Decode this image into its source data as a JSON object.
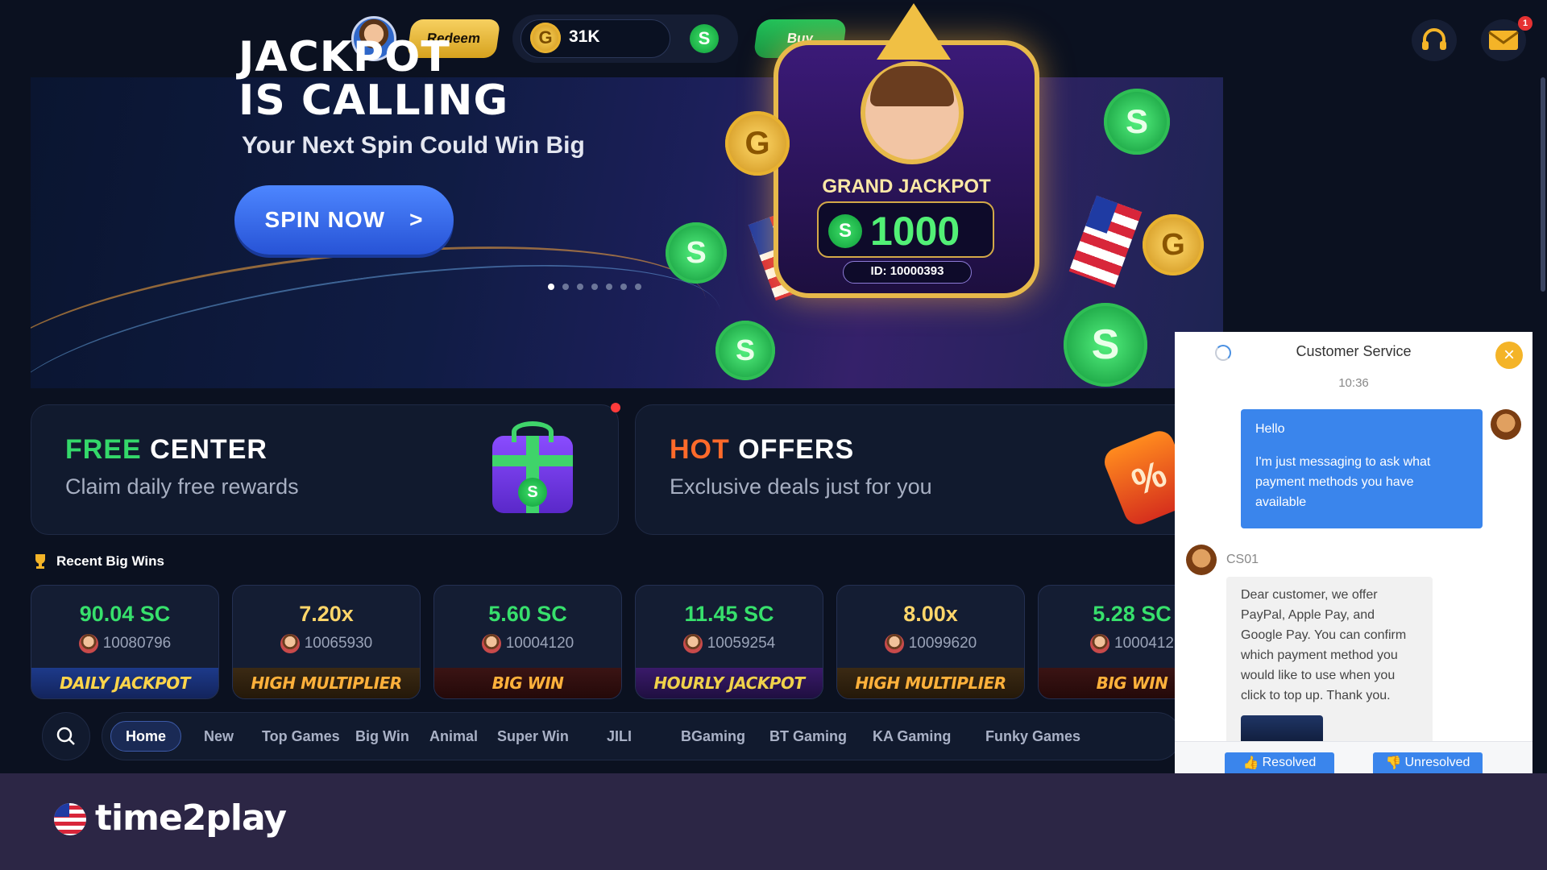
{
  "topbar": {
    "redeem_label": "Redeem",
    "coins_g_value": "31K",
    "coin_g_symbol": "G",
    "coin_s_symbol": "S",
    "buy_label": "Buy",
    "notification_count": "1"
  },
  "banner": {
    "title_line1": "JACKPOT",
    "title_line2": "IS CALLING",
    "subtitle": "Your Next Spin Could Win Big",
    "cta_label": "SPIN NOW",
    "cta_arrow": ">",
    "jackpot_title": "GRAND JACKPOT",
    "jackpot_amount": "1000",
    "jackpot_id": "ID: 10000393",
    "slide_count": 7,
    "active_slide": 1
  },
  "promos": {
    "free_center": {
      "title_accent": "FREE",
      "title_rest": "CENTER",
      "subtitle": "Claim daily free rewards"
    },
    "hot_offers": {
      "title_accent": "HOT",
      "title_rest": "OFFERS",
      "subtitle": "Exclusive deals just for you"
    }
  },
  "recent_wins": {
    "label": "Recent Big Wins",
    "items": [
      {
        "amount": "90.04 SC",
        "user": "10080796",
        "tag": "DAILY JACKPOT"
      },
      {
        "amount": "7.20x",
        "user": "10065930",
        "tag": "HIGH MULTIPLIER"
      },
      {
        "amount": "5.60 SC",
        "user": "10004120",
        "tag": "BIG WIN"
      },
      {
        "amount": "11.45 SC",
        "user": "10059254",
        "tag": "HOURLY JACKPOT"
      },
      {
        "amount": "8.00x",
        "user": "10099620",
        "tag": "HIGH MULTIPLIER"
      },
      {
        "amount": "5.28 SC",
        "user": "1000412",
        "tag": "BIG WIN"
      }
    ]
  },
  "nav": {
    "tabs": [
      "Home",
      "New",
      "Top Games",
      "Big Win",
      "Animal",
      "Super Win",
      "JILI",
      "BGaming",
      "BT Gaming",
      "KA Gaming",
      "Funky Games"
    ]
  },
  "customer_service": {
    "title": "Customer Service",
    "time": "10:36",
    "user_message_line1": "Hello",
    "user_message_line2": "I'm just messaging to ask what payment methods you have available",
    "agent_name": "CS01",
    "agent_message": "Dear customer, we offer PayPal, Apple Pay, and Google Pay. You can confirm which payment method you would like to use when you click to top up. Thank you.",
    "resolved_label": "Resolved",
    "unresolved_label": "Unresolved"
  },
  "brand": {
    "name": "time2play"
  },
  "colors": {
    "background": "#0b1120",
    "accent_green": "#34d86a",
    "accent_orange": "#ff6a2a",
    "accent_blue": "#3a85ec",
    "gold": "#f4b428",
    "brand_strip": "#2c2645"
  },
  "icons": [
    "user-avatar",
    "coin-g-icon",
    "coin-s-icon",
    "headset-icon",
    "mail-icon",
    "gift-icon",
    "discount-tag-icon",
    "trophy-icon",
    "search-icon",
    "close-icon",
    "loading-spinner-icon"
  ]
}
